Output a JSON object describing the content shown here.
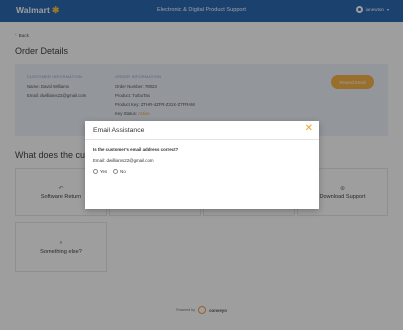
{
  "header": {
    "brand": "Walmart",
    "title": "Electronic & Digital Product Support",
    "username": "ianewton",
    "colors": {
      "bar": "#2d6ab4",
      "spark": "#f7c53b"
    }
  },
  "back_label": "Back",
  "page_title": "Order Details",
  "customer": {
    "heading": "CUSTOMER INFORMATION",
    "name_label": "Name:",
    "name": "David Williams",
    "email_label": "Email:",
    "email": "dwilliams22@gmail.com"
  },
  "order": {
    "heading": "ORDER INFORMATION",
    "number_label": "Order Number:",
    "number": "78023",
    "product_label": "Product:",
    "product": "TurboTax",
    "key_label": "Product Key:",
    "key": "ZTHR-4ZFR-Z31X-Z7FRAM",
    "status_label": "Key Status:",
    "status": "Active",
    "status_color": "#e8a13c"
  },
  "resend_label": "Resend Email",
  "section_title": "What does the customer need help with?",
  "tiles": [
    {
      "label": "Software Return",
      "icon": "return-icon"
    },
    {
      "label": "",
      "icon": ""
    },
    {
      "label": "",
      "icon": ""
    },
    {
      "label": "Download Support",
      "icon": "download-icon"
    },
    {
      "label": "Something else?",
      "icon": "search-icon"
    }
  ],
  "footer": {
    "powered": "Powered by",
    "vendor": "conveyo"
  },
  "modal": {
    "title": "Email Assistance",
    "close": "✕",
    "question": "Is the customer's email address correct?",
    "email_label": "Email:",
    "email": "dwilliams22@gmail.com",
    "yes_label": "Yes",
    "no_label": "No",
    "accent": "#f29e2c"
  }
}
